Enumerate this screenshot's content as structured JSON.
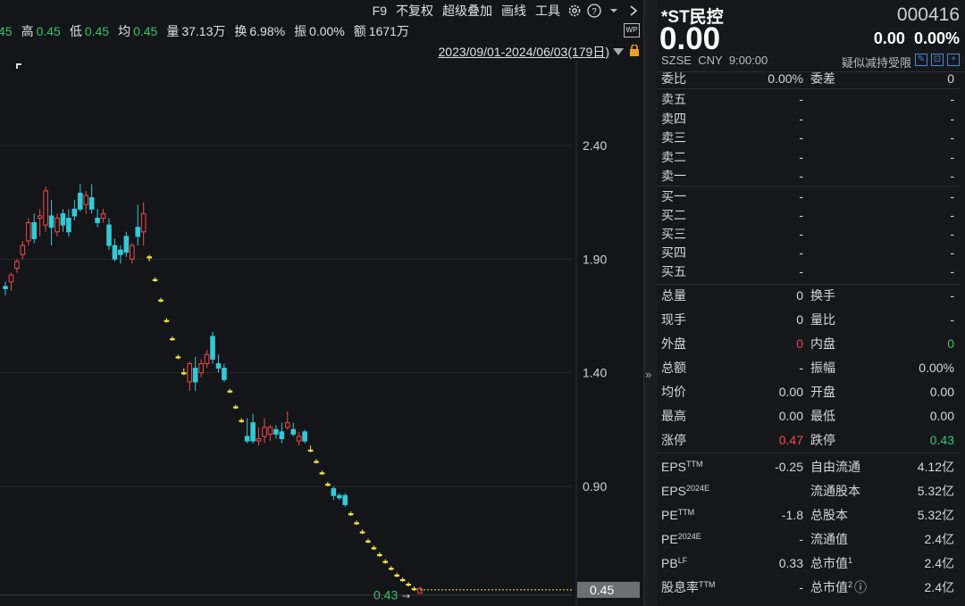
{
  "toolbar": {
    "f9": "F9",
    "fq": "不复权",
    "overlay": "超级叠加",
    "draw": "画线",
    "tools": "工具"
  },
  "stats": {
    "prev_value": "45",
    "high_label": "高",
    "high": "0.45",
    "low_label": "低",
    "low": "0.45",
    "avg_label": "均",
    "avg": "0.45",
    "vol_label": "量",
    "vol": "37.13万",
    "turn_label": "换",
    "turn": "6.98%",
    "amp_label": "振",
    "amp": "0.00%",
    "amt_label": "额",
    "amt": "1671万"
  },
  "date_range": "2023/09/01-2024/06/03(179日)",
  "wp_label": "WP",
  "chart_data": {
    "type": "candlestick",
    "y_ticks": [
      "2.40",
      "1.90",
      "1.40",
      "0.90",
      "0.43"
    ],
    "ylim": [
      0.43,
      2.4
    ],
    "last_price": "0.45",
    "last_price_label": "0.43",
    "colors": {
      "up": "#f04a4a",
      "down": "#33c9d6",
      "flat": "#f5e64a",
      "bg": "#141519"
    },
    "candles": [
      {
        "o": 1.78,
        "h": 1.8,
        "l": 1.74,
        "c": 1.77
      },
      {
        "o": 1.8,
        "h": 1.84,
        "l": 1.76,
        "c": 1.83
      },
      {
        "o": 1.86,
        "h": 1.9,
        "l": 1.84,
        "c": 1.89
      },
      {
        "o": 1.92,
        "h": 1.98,
        "l": 1.9,
        "c": 1.96
      },
      {
        "o": 1.98,
        "h": 2.08,
        "l": 1.96,
        "c": 2.06
      },
      {
        "o": 2.06,
        "h": 2.1,
        "l": 1.97,
        "c": 1.99
      },
      {
        "o": 2.08,
        "h": 2.12,
        "l": 2.0,
        "c": 2.09
      },
      {
        "o": 2.05,
        "h": 2.22,
        "l": 2.02,
        "c": 2.2
      },
      {
        "o": 2.09,
        "h": 2.16,
        "l": 1.96,
        "c": 2.04
      },
      {
        "o": 2.02,
        "h": 2.1,
        "l": 2.0,
        "c": 2.08
      },
      {
        "o": 2.1,
        "h": 2.12,
        "l": 2.02,
        "c": 2.05
      },
      {
        "o": 2.08,
        "h": 2.12,
        "l": 2.0,
        "c": 2.02
      },
      {
        "o": 2.12,
        "h": 2.16,
        "l": 2.07,
        "c": 2.09
      },
      {
        "o": 2.19,
        "h": 2.23,
        "l": 2.11,
        "c": 2.12
      },
      {
        "o": 2.14,
        "h": 2.2,
        "l": 2.1,
        "c": 2.18
      },
      {
        "o": 2.17,
        "h": 2.23,
        "l": 2.1,
        "c": 2.12
      },
      {
        "o": 2.08,
        "h": 2.12,
        "l": 2.04,
        "c": 2.06
      },
      {
        "o": 2.08,
        "h": 2.12,
        "l": 2.06,
        "c": 2.1
      },
      {
        "o": 2.05,
        "h": 2.08,
        "l": 1.94,
        "c": 1.96
      },
      {
        "o": 1.96,
        "h": 1.99,
        "l": 1.89,
        "c": 1.9
      },
      {
        "o": 1.94,
        "h": 1.96,
        "l": 1.88,
        "c": 1.92
      },
      {
        "o": 2.0,
        "h": 2.02,
        "l": 1.91,
        "c": 1.93
      },
      {
        "o": 1.9,
        "h": 1.97,
        "l": 1.88,
        "c": 1.96
      },
      {
        "o": 2.04,
        "h": 2.14,
        "l": 1.96,
        "c": 2.0
      },
      {
        "o": 2.02,
        "h": 2.15,
        "l": 1.96,
        "c": 2.1
      },
      {
        "o": 1.91,
        "h": 1.92,
        "l": 1.89,
        "c": 1.91
      },
      {
        "o": 1.81,
        "h": 1.82,
        "l": 1.8,
        "c": 1.81
      },
      {
        "o": 1.72,
        "h": 1.73,
        "l": 1.71,
        "c": 1.72
      },
      {
        "o": 1.63,
        "h": 1.64,
        "l": 1.62,
        "c": 1.63
      },
      {
        "o": 1.55,
        "h": 1.56,
        "l": 1.54,
        "c": 1.55
      },
      {
        "o": 1.47,
        "h": 1.48,
        "l": 1.46,
        "c": 1.47
      },
      {
        "o": 1.4,
        "h": 1.42,
        "l": 1.39,
        "c": 1.4
      },
      {
        "o": 1.36,
        "h": 1.45,
        "l": 1.32,
        "c": 1.44
      },
      {
        "o": 1.42,
        "h": 1.47,
        "l": 1.32,
        "c": 1.36
      },
      {
        "o": 1.4,
        "h": 1.46,
        "l": 1.38,
        "c": 1.44
      },
      {
        "o": 1.44,
        "h": 1.5,
        "l": 1.42,
        "c": 1.48
      },
      {
        "o": 1.56,
        "h": 1.58,
        "l": 1.44,
        "c": 1.46
      },
      {
        "o": 1.44,
        "h": 1.48,
        "l": 1.4,
        "c": 1.42
      },
      {
        "o": 1.42,
        "h": 1.44,
        "l": 1.36,
        "c": 1.37
      },
      {
        "o": 1.32,
        "h": 1.33,
        "l": 1.31,
        "c": 1.32
      },
      {
        "o": 1.25,
        "h": 1.26,
        "l": 1.24,
        "c": 1.25
      },
      {
        "o": 1.19,
        "h": 1.2,
        "l": 1.18,
        "c": 1.19
      },
      {
        "o": 1.12,
        "h": 1.2,
        "l": 1.09,
        "c": 1.1
      },
      {
        "o": 1.18,
        "h": 1.22,
        "l": 1.09,
        "c": 1.1
      },
      {
        "o": 1.1,
        "h": 1.16,
        "l": 1.08,
        "c": 1.11
      },
      {
        "o": 1.12,
        "h": 1.2,
        "l": 1.09,
        "c": 1.16
      },
      {
        "o": 1.13,
        "h": 1.17,
        "l": 1.1,
        "c": 1.16
      },
      {
        "o": 1.15,
        "h": 1.17,
        "l": 1.11,
        "c": 1.13
      },
      {
        "o": 1.14,
        "h": 1.18,
        "l": 1.09,
        "c": 1.11
      },
      {
        "o": 1.16,
        "h": 1.23,
        "l": 1.15,
        "c": 1.18
      },
      {
        "o": 1.15,
        "h": 1.18,
        "l": 1.12,
        "c": 1.13
      },
      {
        "o": 1.1,
        "h": 1.14,
        "l": 1.08,
        "c": 1.12
      },
      {
        "o": 1.14,
        "h": 1.15,
        "l": 1.09,
        "c": 1.1
      },
      {
        "o": 1.06,
        "h": 1.08,
        "l": 1.05,
        "c": 1.06
      },
      {
        "o": 1.01,
        "h": 1.02,
        "l": 1.0,
        "c": 1.01
      },
      {
        "o": 0.96,
        "h": 0.97,
        "l": 0.95,
        "c": 0.96
      },
      {
        "o": 0.91,
        "h": 0.92,
        "l": 0.9,
        "c": 0.91
      },
      {
        "o": 0.89,
        "h": 0.9,
        "l": 0.84,
        "c": 0.86
      },
      {
        "o": 0.86,
        "h": 0.87,
        "l": 0.84,
        "c": 0.85
      },
      {
        "o": 0.86,
        "h": 0.87,
        "l": 0.81,
        "c": 0.82
      },
      {
        "o": 0.78,
        "h": 0.79,
        "l": 0.77,
        "c": 0.78
      },
      {
        "o": 0.74,
        "h": 0.75,
        "l": 0.73,
        "c": 0.74
      },
      {
        "o": 0.7,
        "h": 0.71,
        "l": 0.69,
        "c": 0.7
      },
      {
        "o": 0.66,
        "h": 0.67,
        "l": 0.65,
        "c": 0.66
      },
      {
        "o": 0.63,
        "h": 0.64,
        "l": 0.62,
        "c": 0.63
      },
      {
        "o": 0.6,
        "h": 0.61,
        "l": 0.59,
        "c": 0.6
      },
      {
        "o": 0.57,
        "h": 0.58,
        "l": 0.56,
        "c": 0.57
      },
      {
        "o": 0.54,
        "h": 0.55,
        "l": 0.53,
        "c": 0.54
      },
      {
        "o": 0.51,
        "h": 0.52,
        "l": 0.5,
        "c": 0.51
      },
      {
        "o": 0.49,
        "h": 0.5,
        "l": 0.48,
        "c": 0.49
      },
      {
        "o": 0.47,
        "h": 0.48,
        "l": 0.46,
        "c": 0.47
      },
      {
        "o": 0.45,
        "h": 0.46,
        "l": 0.44,
        "c": 0.45
      },
      {
        "o": 0.43,
        "h": 0.46,
        "l": 0.43,
        "c": 0.45
      }
    ]
  },
  "quote": {
    "name": "*ST民控",
    "code": "000416",
    "price": "0.00",
    "change": "0.00",
    "change_pct": "0.00%",
    "market": "SZSE",
    "currency": "CNY",
    "time": "9:00:00",
    "note": "疑似减持受限"
  },
  "order_book_top": {
    "wb_label": "委比",
    "wb_value": "0.00%",
    "wc_label": "委差",
    "wc_value": "0"
  },
  "asks": [
    {
      "label": "卖五",
      "price": "-",
      "vol": "-"
    },
    {
      "label": "卖四",
      "price": "-",
      "vol": "-"
    },
    {
      "label": "卖三",
      "price": "-",
      "vol": "-"
    },
    {
      "label": "卖二",
      "price": "-",
      "vol": "-"
    },
    {
      "label": "卖一",
      "price": "-",
      "vol": "-"
    }
  ],
  "bids": [
    {
      "label": "买一",
      "price": "-",
      "vol": "-"
    },
    {
      "label": "买二",
      "price": "-",
      "vol": "-"
    },
    {
      "label": "买三",
      "price": "-",
      "vol": "-"
    },
    {
      "label": "买四",
      "price": "-",
      "vol": "-"
    },
    {
      "label": "买五",
      "price": "-",
      "vol": "-"
    }
  ],
  "stats_grid": [
    {
      "l1": "总量",
      "v1": "0",
      "l2": "换手",
      "v2": "-"
    },
    {
      "l1": "现手",
      "v1": "0",
      "l2": "量比",
      "v2": "-"
    },
    {
      "l1": "外盘",
      "v1": "0",
      "l2": "内盘",
      "v2": "0"
    },
    {
      "l1": "总额",
      "v1": "-",
      "l2": "振幅",
      "v2": "0.00%"
    },
    {
      "l1": "均价",
      "v1": "0.00",
      "l2": "开盘",
      "v2": "0.00"
    },
    {
      "l1": "最高",
      "v1": "0.00",
      "l2": "最低",
      "v2": "0.00"
    },
    {
      "l1": "涨停",
      "v1": "0.47",
      "l2": "跌停",
      "v2": "0.43"
    }
  ],
  "fundamentals": [
    {
      "l1": "EPS",
      "s1": "TTM",
      "v1": "-0.25",
      "l2": "自由流通",
      "s2": "",
      "v2": "4.12亿"
    },
    {
      "l1": "EPS",
      "s1": "2024E",
      "v1": "",
      "l2": "流通股本",
      "s2": "",
      "v2": "5.32亿"
    },
    {
      "l1": "PE",
      "s1": "TTM",
      "v1": "-1.8",
      "l2": "总股本",
      "s2": "",
      "v2": "5.32亿"
    },
    {
      "l1": "PE",
      "s1": "2024E",
      "v1": "-",
      "l2": "流通值",
      "s2": "",
      "v2": "2.4亿"
    },
    {
      "l1": "PB",
      "s1": "LF",
      "v1": "0.33",
      "l2": "总市值",
      "s2": "1",
      "v2": "2.4亿"
    },
    {
      "l1": "股息率",
      "s1": "TTM",
      "v1": "-",
      "l2": "总市值",
      "s2": "2",
      "v2": "2.4亿"
    }
  ]
}
